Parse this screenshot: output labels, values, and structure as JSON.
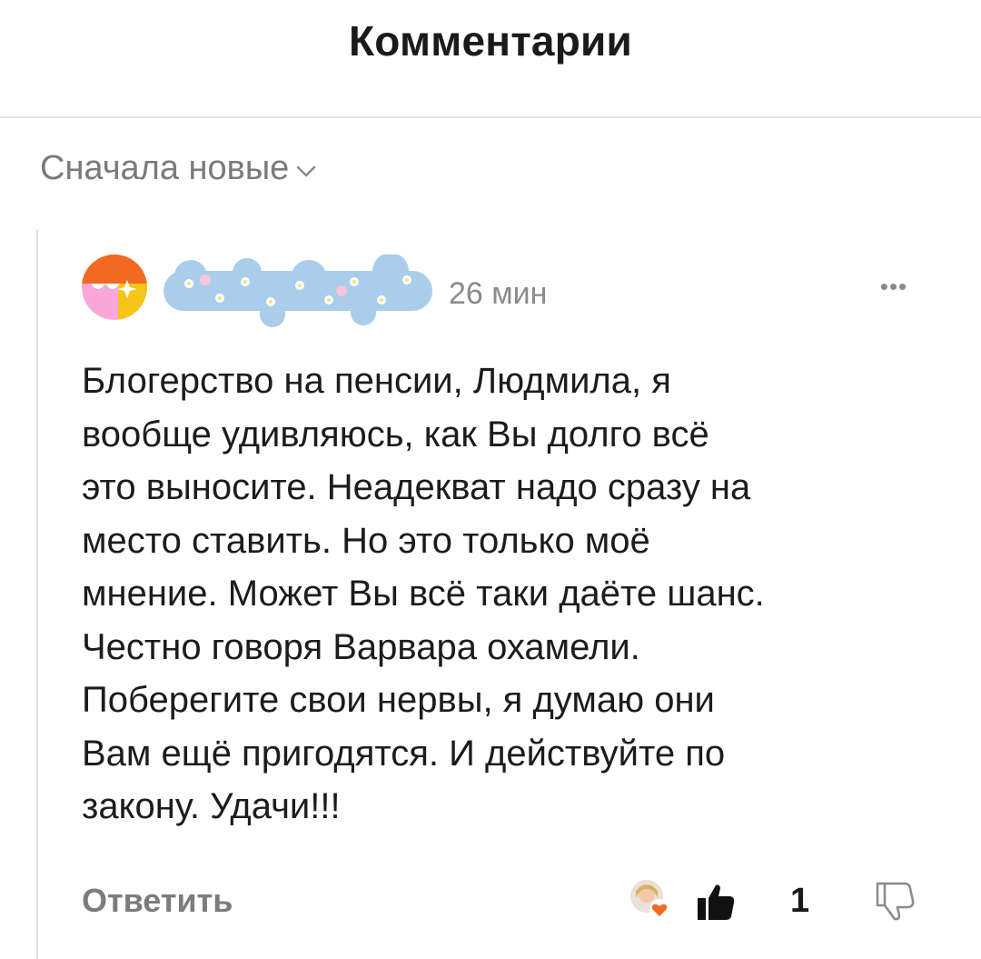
{
  "header": {
    "title": "Комментарии"
  },
  "sort": {
    "label": "Сначала новые",
    "icon": "chevron-down-icon"
  },
  "comment": {
    "time": "26 мин",
    "more_label": "•••",
    "text_lines": [
      "Блогерство на пенсии, Людмила, я",
      "вообще удивляюсь, как Вы долго всё",
      "это выносите. Неадекват надо сразу на",
      "место ставить. Но это только моё",
      "мнение. Может Вы всё таки даёте шанс.",
      "Честно говоря Варвара охамели.",
      "Поберегите свои нервы, я думаю они",
      "Вам ещё пригодятся. И действуйте по",
      "закону. Удачи!!!"
    ],
    "reply_label": "Ответить",
    "like_count": "1"
  },
  "colors": {
    "accent_orange": "#F26A21",
    "avatar_pink": "#F7A8D8",
    "avatar_yellow": "#F5C518",
    "redaction_blue": "#A9CDEB"
  }
}
